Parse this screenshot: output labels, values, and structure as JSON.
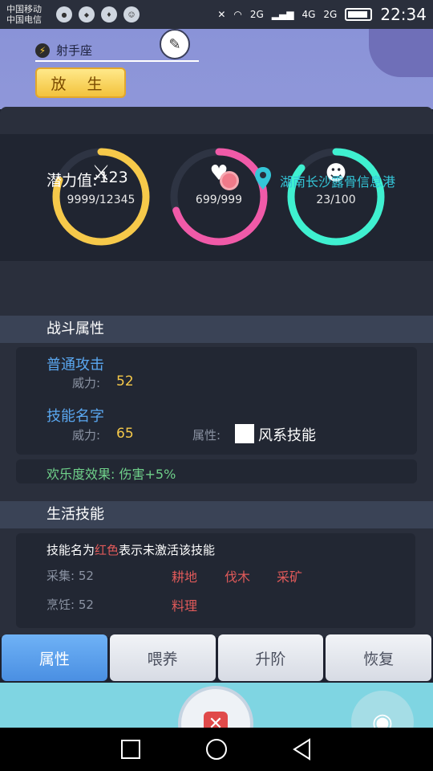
{
  "status_bar": {
    "carrier_1": "中国移动",
    "carrier_2": "中国电信",
    "network_1": "2G",
    "network_2": "4G",
    "network_3": "2G",
    "time": "22:34"
  },
  "header": {
    "constellation": "射手座",
    "release_label": "放 生"
  },
  "stats": {
    "attack": {
      "value": "9999/12345",
      "fill": 0.81,
      "color": "#f6c94a",
      "icon": "crossed-swords-icon"
    },
    "health": {
      "value": "699/999",
      "fill": 0.7,
      "color": "#f05aa8",
      "icon": "heart-icon"
    },
    "joy": {
      "value": "23/100",
      "fill": 0.86,
      "color": "#3ff0d0",
      "icon": "smiley-icon"
    }
  },
  "potential": {
    "label": "潜力值:",
    "value": "123"
  },
  "location": "湖南长沙露骨信息港",
  "battle": {
    "title": "战斗属性",
    "normal_attack": {
      "name": "普通攻击",
      "power_label": "威力:",
      "power": "52"
    },
    "skill": {
      "name": "技能名字",
      "power_label": "威力:",
      "power": "65",
      "attr_label": "属性:",
      "attr_value": "风系技能"
    },
    "joy_effect": "欢乐度效果: 伤害+5%"
  },
  "life": {
    "title": "生活技能",
    "note_prefix": "技能名为",
    "note_red": "红色",
    "note_suffix": "表示未激活该技能",
    "gather": {
      "label": "采集: 52",
      "skills": [
        "耕地",
        "伐木",
        "采矿"
      ]
    },
    "cook": {
      "label": "烹饪: 52",
      "skills": [
        "料理"
      ]
    }
  },
  "tabs": [
    "属性",
    "喂养",
    "升阶",
    "恢复"
  ],
  "active_tab": 0
}
